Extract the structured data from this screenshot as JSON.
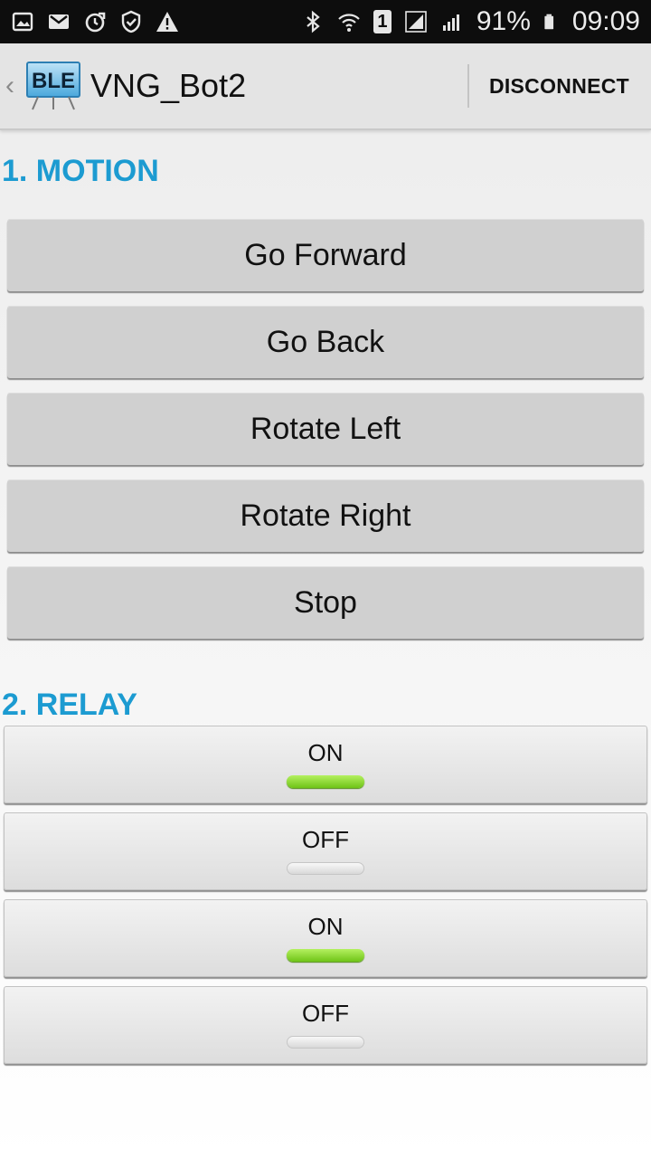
{
  "status_bar": {
    "battery_percent": "91%",
    "time": "09:09",
    "sim_slot": "1",
    "left_icons": [
      "gallery-icon",
      "gmail-icon",
      "sync-icon",
      "shield-icon",
      "warning-icon"
    ],
    "right_icons": [
      "bluetooth-icon",
      "wifi-icon",
      "sim-icon",
      "signal-icon",
      "signal-icon",
      "battery-icon"
    ]
  },
  "action_bar": {
    "logo_text": "BLE",
    "title": "VNG_Bot2",
    "disconnect_label": "DISCONNECT"
  },
  "motion": {
    "heading": "1. MOTION",
    "buttons": [
      "Go Forward",
      "Go Back",
      "Rotate Left",
      "Rotate Right",
      "Stop"
    ]
  },
  "relay": {
    "heading": "2. RELAY",
    "toggles": [
      {
        "label": "ON",
        "state": "on"
      },
      {
        "label": "OFF",
        "state": "off"
      },
      {
        "label": "ON",
        "state": "on"
      },
      {
        "label": "OFF",
        "state": "off"
      }
    ]
  },
  "colors": {
    "accent": "#1c9bd1",
    "indicator_on": "#7ed321",
    "status_bar_bg": "#0d0d0d"
  }
}
